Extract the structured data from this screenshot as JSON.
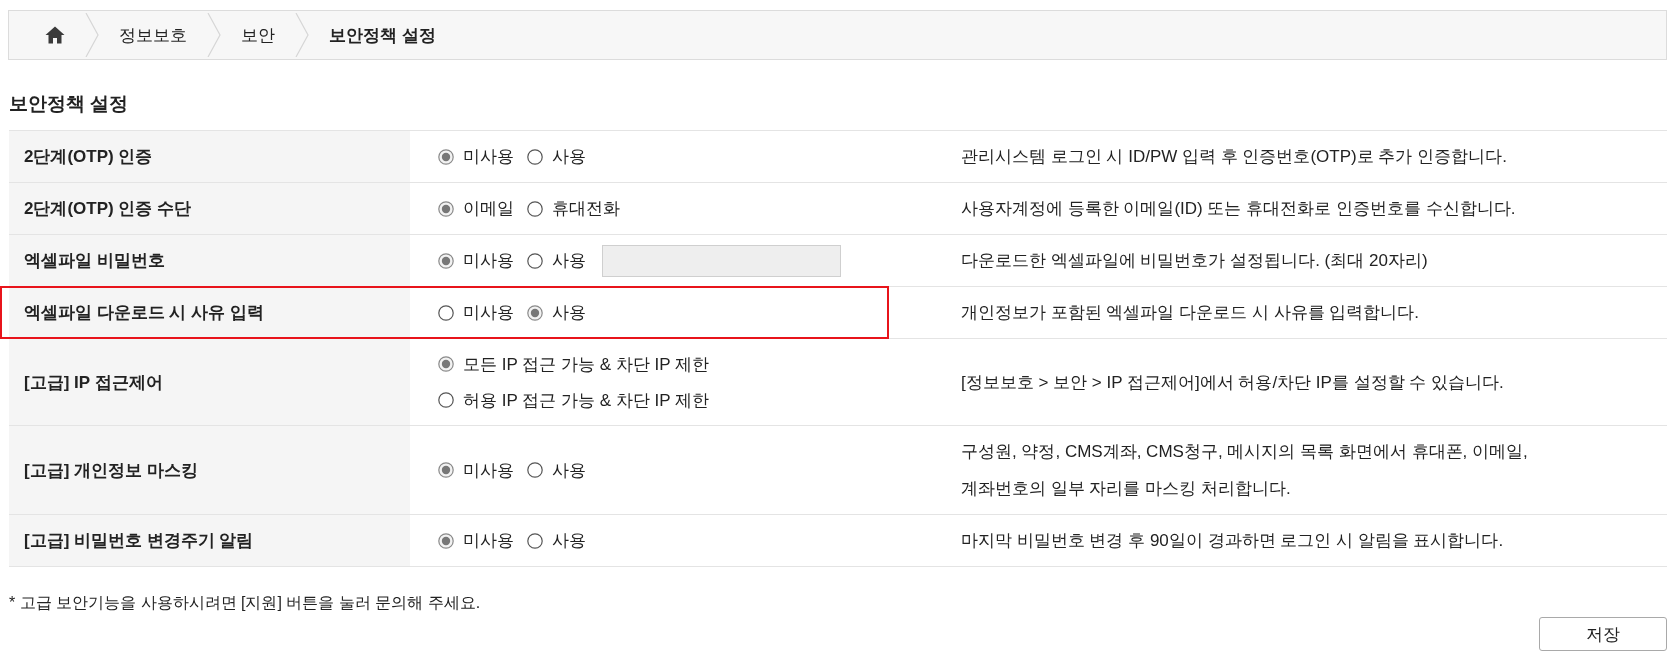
{
  "breadcrumb": {
    "items": [
      {
        "label": "정보보호",
        "current": false
      },
      {
        "label": "보안",
        "current": false
      },
      {
        "label": "보안정책 설정",
        "current": true
      }
    ]
  },
  "section_title": "보안정책 설정",
  "settings": [
    {
      "kind": "radio",
      "label": "2단계(OTP) 인증",
      "options": [
        {
          "label": "미사용",
          "selected": true
        },
        {
          "label": "사용",
          "selected": false
        }
      ],
      "description": "관리시스템 로그인 시 ID/PW 입력 후 인증번호(OTP)로 추가 인증합니다.",
      "highlighted": false
    },
    {
      "kind": "radio",
      "label": "2단계(OTP) 인증 수단",
      "options": [
        {
          "label": "이메일",
          "selected": true
        },
        {
          "label": "휴대전화",
          "selected": false
        }
      ],
      "description": "사용자계정에 등록한 이메일(ID) 또는 휴대전화로 인증번호를 수신합니다.",
      "highlighted": false
    },
    {
      "kind": "radio-field",
      "label": "엑셀파일 비밀번호",
      "options": [
        {
          "label": "미사용",
          "selected": true
        },
        {
          "label": "사용",
          "selected": false
        }
      ],
      "field": {
        "disabled": true
      },
      "description": "다운로드한 엑셀파일에 비밀번호가 설정됩니다. (최대 20자리)",
      "highlighted": false
    },
    {
      "kind": "radio",
      "label": "엑셀파일 다운로드 시 사유 입력",
      "options": [
        {
          "label": "미사용",
          "selected": false
        },
        {
          "label": "사용",
          "selected": true
        }
      ],
      "description": "개인정보가 포함된 엑셀파일 다운로드 시 사유를 입력합니다.",
      "highlighted": true
    },
    {
      "kind": "radio-stacked",
      "label": "[고급] IP 접근제어",
      "options": [
        {
          "label": "모든 IP 접근 가능 & 차단 IP 제한",
          "selected": true
        },
        {
          "label": "허용 IP 접근 가능 & 차단 IP 제한",
          "selected": false
        }
      ],
      "description": "[정보보호 > 보안 > IP 접근제어]에서 허용/차단 IP를 설정할 수 있습니다.",
      "highlighted": false
    },
    {
      "kind": "radio",
      "label": "[고급] 개인정보 마스킹",
      "options": [
        {
          "label": "미사용",
          "selected": true
        },
        {
          "label": "사용",
          "selected": false
        }
      ],
      "description": "구성원, 약정, CMS계좌, CMS청구, 메시지의 목록 화면에서 휴대폰, 이메일,\n계좌번호의 일부 자리를 마스킹 처리합니다.",
      "highlighted": false
    },
    {
      "kind": "radio",
      "label": "[고급] 비밀번호 변경주기 알림",
      "options": [
        {
          "label": "미사용",
          "selected": true
        },
        {
          "label": "사용",
          "selected": false
        }
      ],
      "description": "마지막 비밀번호 변경 후 90일이 경과하면 로그인 시 알림을 표시합니다.",
      "highlighted": false
    }
  ],
  "footnote": "* 고급 보안기능을 사용하시려면 [지원] 버튼을 눌러 문의해 주세요.",
  "save_button": "저장"
}
